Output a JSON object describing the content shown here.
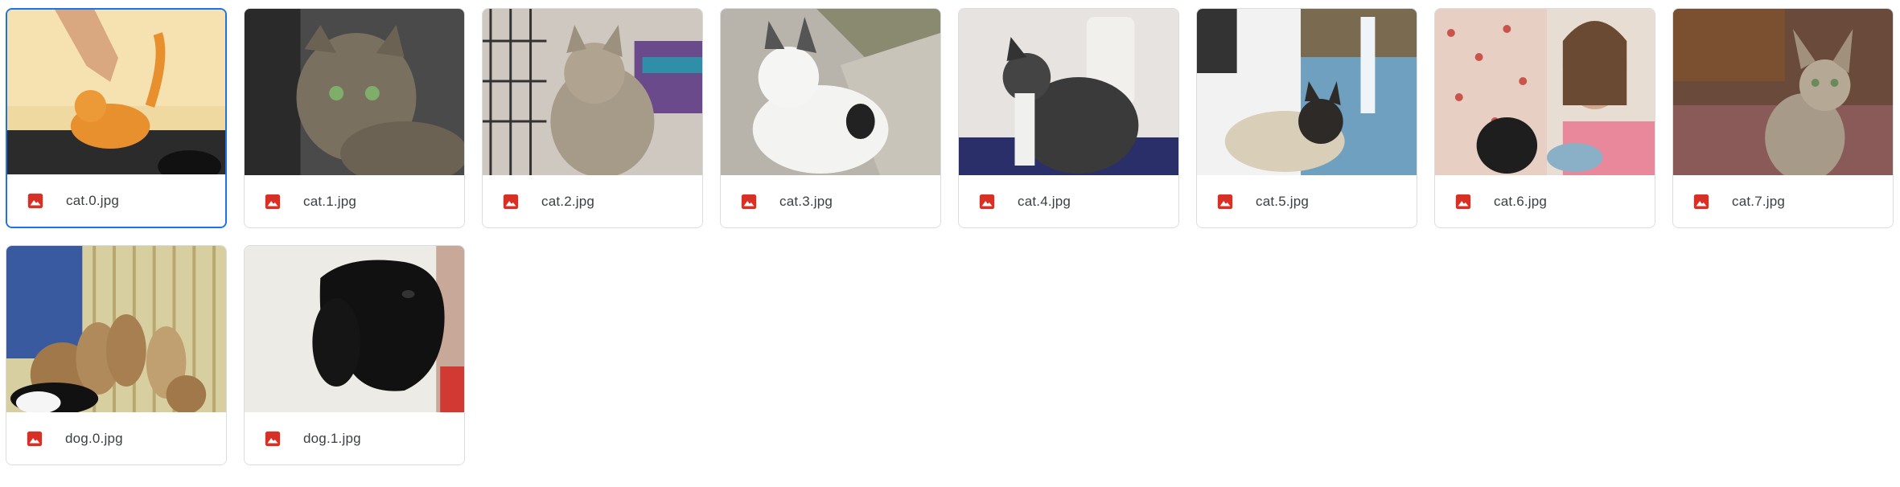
{
  "files": [
    {
      "name": "cat.0.jpg",
      "icon": "image-file-icon",
      "selected": true
    },
    {
      "name": "cat.1.jpg",
      "icon": "image-file-icon",
      "selected": false
    },
    {
      "name": "cat.2.jpg",
      "icon": "image-file-icon",
      "selected": false
    },
    {
      "name": "cat.3.jpg",
      "icon": "image-file-icon",
      "selected": false
    },
    {
      "name": "cat.4.jpg",
      "icon": "image-file-icon",
      "selected": false
    },
    {
      "name": "cat.5.jpg",
      "icon": "image-file-icon",
      "selected": false
    },
    {
      "name": "cat.6.jpg",
      "icon": "image-file-icon",
      "selected": false
    },
    {
      "name": "cat.7.jpg",
      "icon": "image-file-icon",
      "selected": false
    },
    {
      "name": "dog.0.jpg",
      "icon": "image-file-icon",
      "selected": false
    },
    {
      "name": "dog.1.jpg",
      "icon": "image-file-icon",
      "selected": false
    }
  ],
  "colors": {
    "selection_border": "#1a73e8",
    "card_border": "#dadce0",
    "image_icon": "#d93025",
    "text": "#3c4043"
  }
}
